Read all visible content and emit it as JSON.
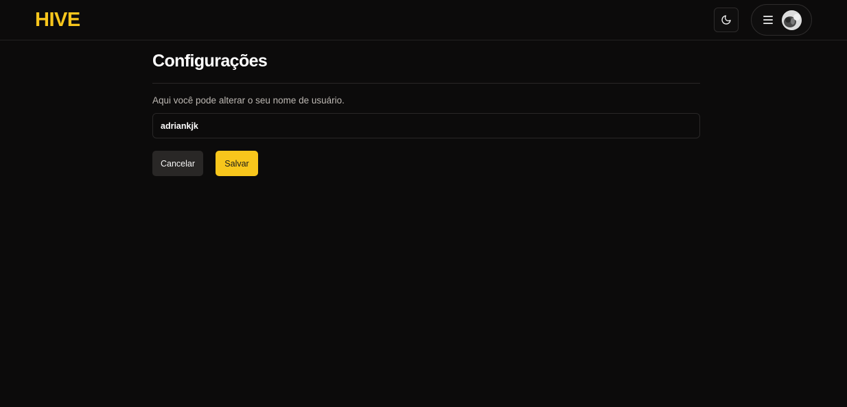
{
  "header": {
    "logo": "HIVE",
    "theme_toggle_icon": "moon-icon",
    "menu_icon": "hamburger-menu-icon",
    "avatar_icon": "user-avatar"
  },
  "settings": {
    "title": "Configurações",
    "description": "Aqui você pode alterar o seu nome de usuário.",
    "username_value": "adriankjk",
    "cancel_label": "Cancelar",
    "save_label": "Salvar"
  },
  "colors": {
    "accent": "#f8c61c",
    "background": "#0c0b0b",
    "cancel_button": "#292726"
  }
}
